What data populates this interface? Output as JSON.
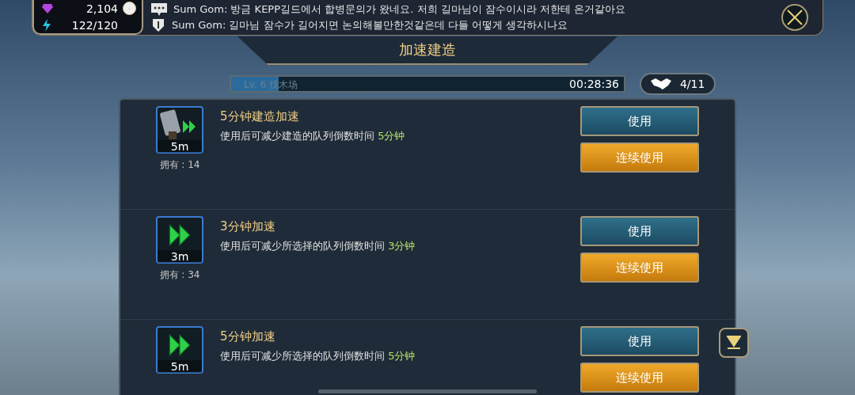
{
  "resources": {
    "gems": "2,104",
    "energy": "122/120"
  },
  "chat": [
    {
      "kind": "message",
      "text": "Sum Gom: 방금 KEPP길드에서 합병문의가 왔네요. 저희 길마님이 잠수이시라 저한테 온거같아요"
    },
    {
      "kind": "guild",
      "text": "Sum Gom: 길마님 잠수가 길어지면 논의해볼만한것같은데 다들 어떻게 생각하시나요"
    }
  ],
  "title": "加速建造",
  "progress": {
    "label": "Lv. 6 伐木场",
    "time": "00:28:36",
    "level": 0.12
  },
  "help": {
    "count": "4/11"
  },
  "items": [
    {
      "kind": "hammer",
      "icon_label": "5m",
      "title": "5分钟建造加速",
      "description": "使用后可减少建造的队列倒数时间",
      "amount": "5分钟",
      "owned": "拥有 : 14",
      "use": "使用",
      "use_multi": "连续使用"
    },
    {
      "kind": "arrows",
      "icon_label": "3m",
      "title": "3分钟加速",
      "description": "使用后可减少所选择的队列倒数时间",
      "amount": "3分钟",
      "owned": "拥有 : 34",
      "use": "使用",
      "use_multi": "连续使用"
    },
    {
      "kind": "arrows",
      "icon_label": "5m",
      "title": "5分钟加速",
      "description": "使用后可减少所选择的队列倒数时间",
      "amount": "5分钟",
      "use": "使用",
      "use_multi": "连续使用"
    }
  ]
}
